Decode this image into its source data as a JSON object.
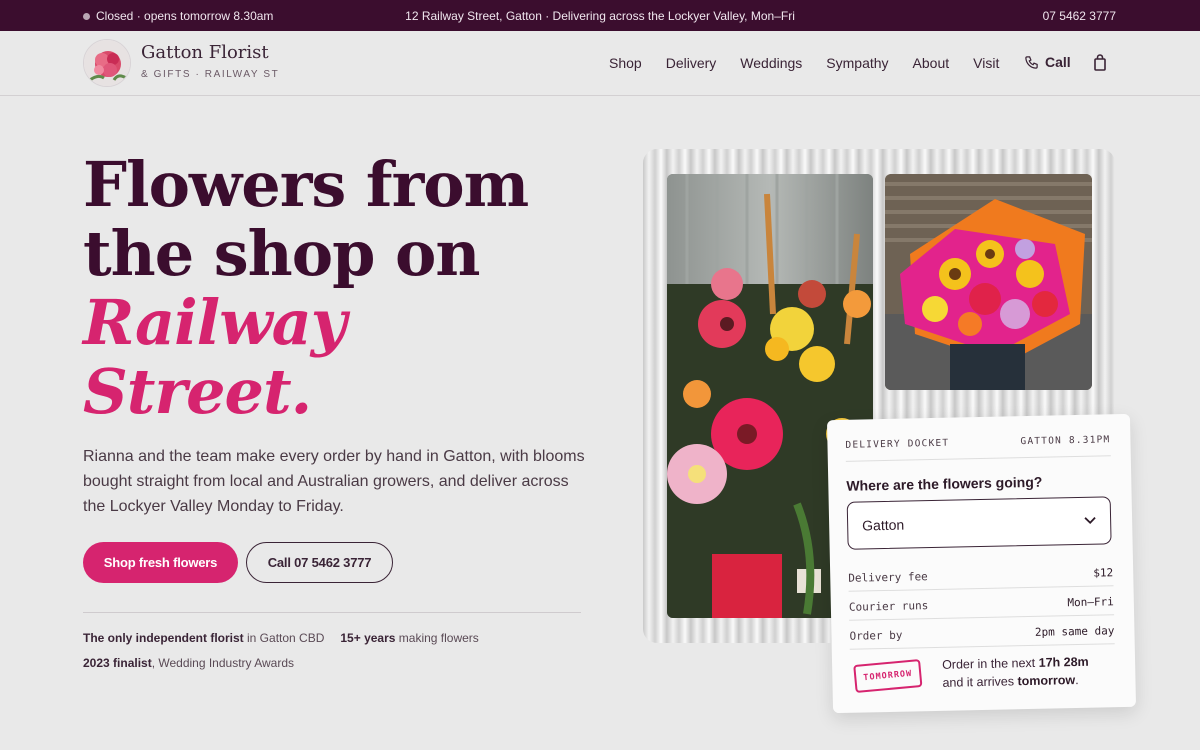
{
  "topbar": {
    "status": "Closed · opens tomorrow 8.30am",
    "address": "12 Railway Street, Gatton · Delivering across the Lockyer Valley, Mon–Fri",
    "phone": "07 5462 3777"
  },
  "header": {
    "brand_name": "Gatton Florist",
    "brand_sub": "& GIFTS · RAILWAY ST",
    "nav": [
      "Shop",
      "Delivery",
      "Weddings",
      "Sympathy",
      "About",
      "Visit"
    ],
    "call_label": "Call"
  },
  "hero": {
    "title_line1": "Flowers from",
    "title_line2": "the shop on",
    "title_accent1": "Railway",
    "title_accent2": "Street.",
    "intro": "Rianna and the team make every order by hand in Gatton, with blooms bought straight from local and Australian growers, and deliver across the Lockyer Valley Monday to Friday.",
    "primary_cta": "Shop fresh flowers",
    "secondary_cta": "Call 07 5462 3777"
  },
  "stats": {
    "s1_bold": "The only independent florist",
    "s1_rest": " in Gatton CBD",
    "s2_bold": "15+ years",
    "s2_rest": " making flowers",
    "s3_bold": "2023 finalist",
    "s3_rest": ", Wedding Industry Awards"
  },
  "docket": {
    "label": "DELIVERY DOCKET",
    "time": "GATTON 8.31PM",
    "question": "Where are the flowers going?",
    "selected_town": "Gatton",
    "rows": [
      {
        "label": "Delivery fee",
        "value": "$12"
      },
      {
        "label": "Courier runs",
        "value": "Mon–Fri"
      },
      {
        "label": "Order by",
        "value": "2pm same day"
      }
    ],
    "stamp": "TOMORROW",
    "note_pre": "Order in the next ",
    "note_time": "17h 28m",
    "note_mid": "and it arrives ",
    "note_day": "tomorrow",
    "note_end": "."
  },
  "colors": {
    "brand_dark": "#3b0d2e",
    "accent_pink": "#d6246f",
    "page_bg": "#e9e9e9"
  }
}
